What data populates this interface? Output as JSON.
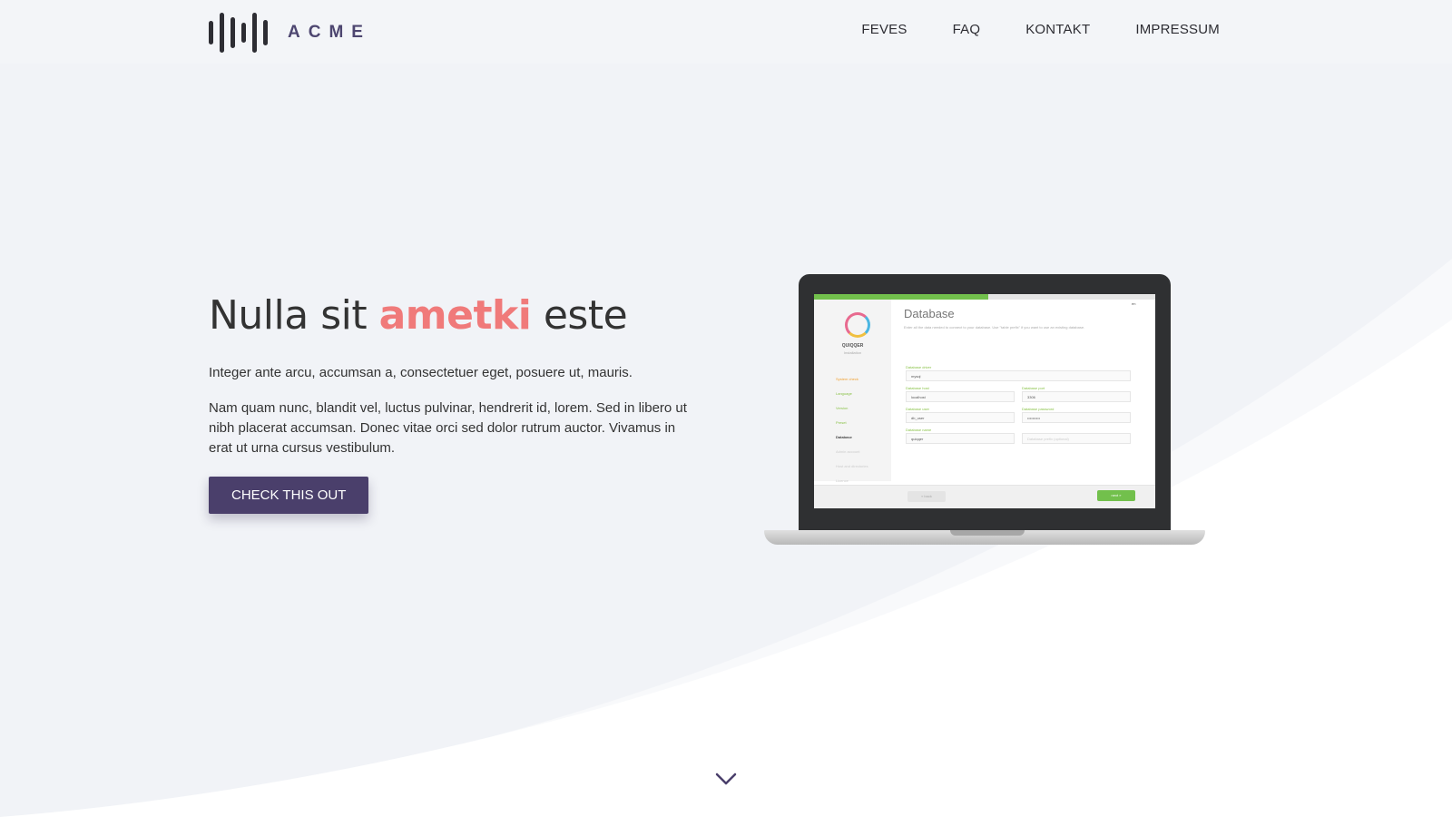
{
  "header": {
    "logo_text": "ACME",
    "nav": [
      "FEVES",
      "FAQ",
      "KONTAKT",
      "IMPRESSUM"
    ]
  },
  "hero": {
    "title_pre": "Nulla sit ",
    "title_accent": "ametki",
    "title_post": " este",
    "lead": "Integer ante arcu, accumsan a, consectetuer eget, posuere ut, mauris.",
    "body": "Nam quam nunc, blandit vel, luctus pulvinar, hendrerit id, lorem. Sed in libero ut nibh placerat accumsan. Donec vitae orci sed dolor rutrum auctor. Vivamus in erat ut urna cursus vestibulum.",
    "cta": "CHECK THIS OUT"
  },
  "laptop_screen": {
    "brand": "QUIQQER",
    "brand_sub": "Installation",
    "lang": "en",
    "steps": [
      "System check",
      "Language",
      "Version",
      "Preset",
      "Database",
      "Admin account",
      "Host and directories",
      "Licence"
    ],
    "title": "Database",
    "description": "Enter all the data needed to connect to your database. Use \"table prefix\" if you want to use an existing database.",
    "fields": {
      "driver_label": "Database driver",
      "driver_value": "mysql",
      "host_label": "Database host",
      "host_value": "localhost",
      "port_label": "Database port",
      "port_value": "3306",
      "user_label": "Database user",
      "user_value": "db_user",
      "password_label": "Database password",
      "password_value": "••••••••••",
      "name_label": "Database name",
      "name_value": "quiqqer",
      "prefix_placeholder": "Database prefix (optional)"
    },
    "back": "« back",
    "next": "next »",
    "progress": 0.51
  },
  "colors": {
    "accent": "#f07a7a",
    "brand": "#4a3f6b",
    "background": "#f1f3f7",
    "installer_green": "#72c04c"
  },
  "icons": {
    "scroll_down": "chevron-down-icon",
    "dropdown": "chevron-down-icon"
  }
}
